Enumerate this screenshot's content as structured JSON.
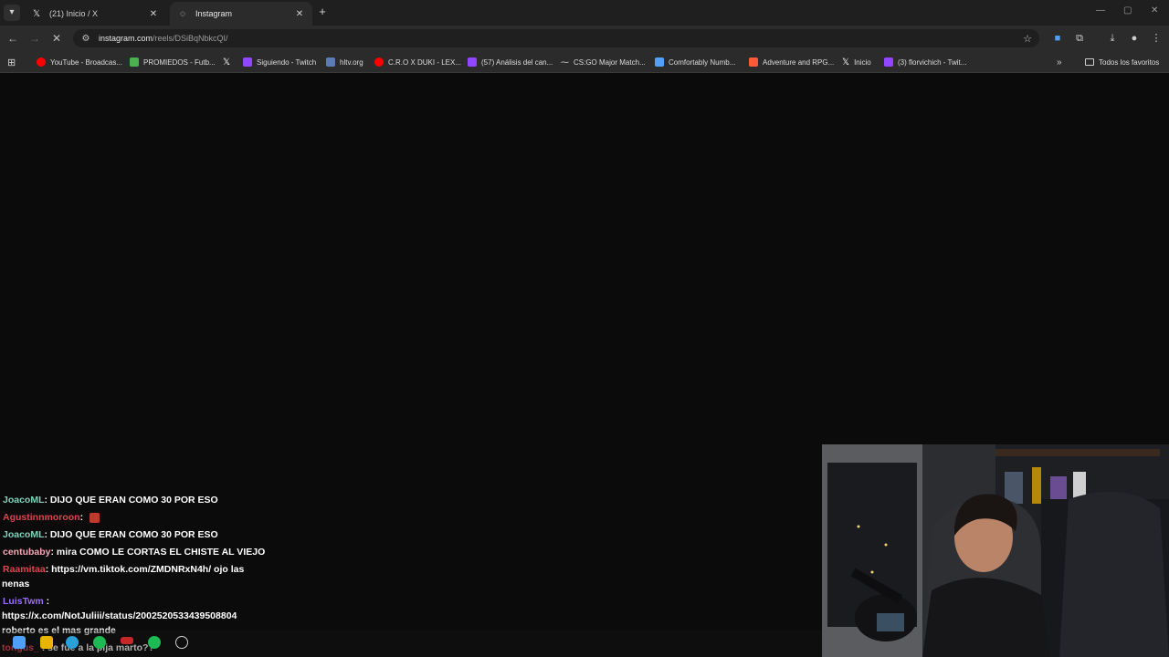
{
  "browser": {
    "tabs": [
      {
        "title": "(21) Inicio / X",
        "icon": "x-logo-icon",
        "active": false
      },
      {
        "title": "Instagram",
        "icon": "loading-icon",
        "active": true
      }
    ],
    "url": {
      "host": "instagram.com",
      "path": "/reels/DSiBqNbkcQI/"
    },
    "bookmarks": [
      {
        "label": "YouTube - Broadcas...",
        "icon": "youtube-icon",
        "color": "#ff0000"
      },
      {
        "label": "PROMIEDOS - Futb...",
        "icon": "promiedos-icon",
        "color": "#4caf50"
      },
      {
        "label": "",
        "icon": "x-logo-icon",
        "color": "#ffffff"
      },
      {
        "label": "Siguiendo - Twitch",
        "icon": "twitch-icon",
        "color": "#9146ff"
      },
      {
        "label": "hltv.org",
        "icon": "hltv-icon",
        "color": "#5b7bb5"
      },
      {
        "label": "C.R.O X DUKI - LEX...",
        "icon": "youtube-icon",
        "color": "#ff0000"
      },
      {
        "label": "(57) Análisis del can...",
        "icon": "twitch-icon",
        "color": "#9146ff"
      },
      {
        "label": "CS:GO Major Match...",
        "icon": "csgo-icon",
        "color": "#cfcfcf"
      },
      {
        "label": "Comfortably Numb...",
        "icon": "page-icon",
        "color": "#4ea1ff"
      },
      {
        "label": "Adventure and RPG...",
        "icon": "game-icon",
        "color": "#ff5a36"
      },
      {
        "label": "Inicio",
        "icon": "x-logo-icon",
        "color": "#ffffff"
      },
      {
        "label": "(3) florvichich - Twit...",
        "icon": "twitch-icon",
        "color": "#9146ff"
      }
    ],
    "all_bookmarks_label": "Todos los favoritos"
  },
  "chat": {
    "messages": [
      {
        "user": "JoacoML",
        "user_color": "#7fd1b9",
        "text": ": DIJO QUE ERAN COMO 30 POR ESO"
      },
      {
        "user": "Agustinnmoroon",
        "user_color": "#e0434f",
        "text": ": "
      },
      {
        "user": "JoacoML",
        "user_color": "#7fd1b9",
        "text": ": DIJO QUE ERAN COMO 30 POR ESO"
      },
      {
        "user": "centubaby",
        "user_color": "#f3a7b5",
        "text": ": mira COMO LE CORTAS EL CHISTE AL VIEJO"
      },
      {
        "user": "Raamitaa",
        "user_color": "#e0434f",
        "text": ": https://vm.tiktok.com/ZMDNRxN4h/ ojo las"
      },
      {
        "user": "",
        "user_color": "#ffffff",
        "text": "nenas"
      },
      {
        "user": "LuisTwm",
        "user_color": "#9b6bff",
        "text": " :"
      },
      {
        "user": "",
        "user_color": "#ffffff",
        "text": "https://x.com/NotJuliii/status/2002520533439508804"
      },
      {
        "user": "",
        "user_color": "#ffffff",
        "text": "roberto es el mas grande"
      },
      {
        "user": "tongus_",
        "user_color": "#e0434f",
        "text": " : se fue a la pija marto??"
      }
    ]
  },
  "colors": {
    "tabstrip": "#1f1f1f",
    "toolbar": "#2b2b2b",
    "page": "#0b0b0b"
  }
}
